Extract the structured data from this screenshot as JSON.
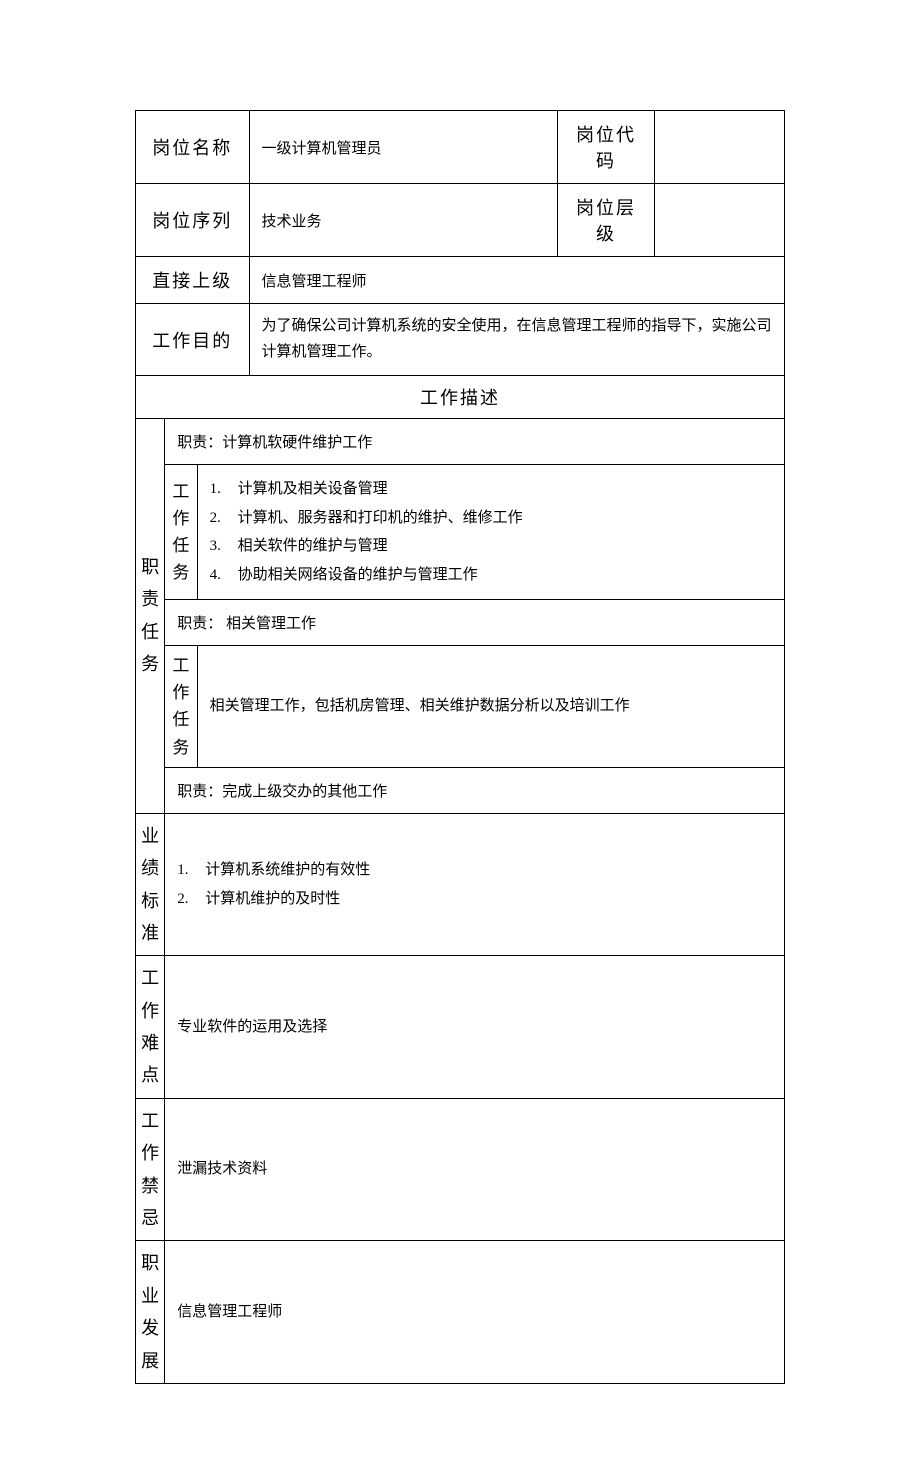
{
  "header": {
    "positionNameLabel": "岗位名称",
    "positionNameValue": "一级计算机管理员",
    "positionCodeLabel": "岗位代码",
    "positionCodeValue": "",
    "positionSeriesLabel": "岗位序列",
    "positionSeriesValue": "技术业务",
    "positionLevelLabel": "岗位层级",
    "positionLevelValue": "",
    "directSupervisorLabel": "直接上级",
    "directSupervisorValue": "信息管理工程师",
    "workPurposeLabel": "工作目的",
    "workPurposeValue": "为了确保公司计算机系统的安全使用，在信息管理工程师的指导下，实施公司计算机管理工作。"
  },
  "sectionTitle": "工作描述",
  "sideLabels": {
    "duties": "职责任务",
    "tasks": "工作任务",
    "performance": "业绩标准",
    "difficulties": "工作难点",
    "taboos": "工作禁忌",
    "career": "职业发展"
  },
  "duties": {
    "d1": {
      "title": "职责：计算机软硬件维护工作",
      "tasks": [
        "计算机及相关设备管理",
        "计算机、服务器和打印机的维护、维修工作",
        "相关软件的维护与管理",
        "协助相关网络设备的维护与管理工作"
      ]
    },
    "d2": {
      "title": "职责：  相关管理工作",
      "tasks": "相关管理工作，包括机房管理、相关维护数据分析以及培训工作"
    },
    "d3": {
      "title": "职责：完成上级交办的其他工作"
    }
  },
  "performance": [
    "计算机系统维护的有效性",
    "计算机维护的及时性"
  ],
  "difficulties": "专业软件的运用及选择",
  "taboos": "泄漏技术资料",
  "career": "信息管理工程师"
}
